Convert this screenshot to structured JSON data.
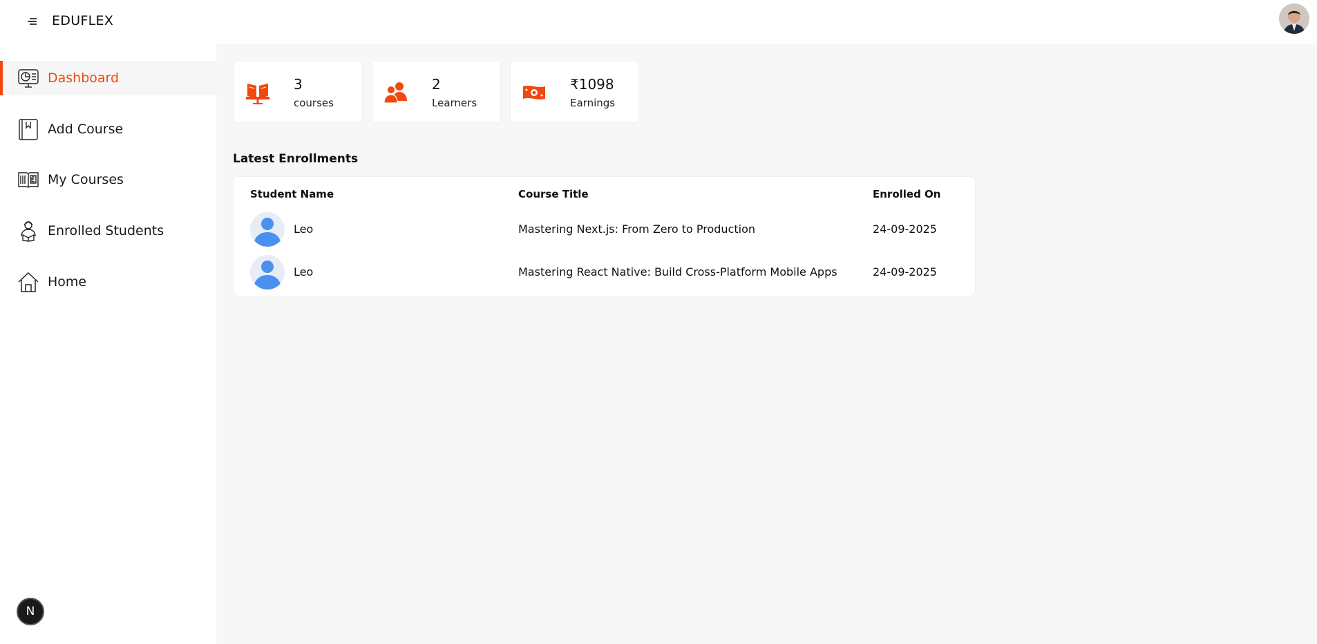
{
  "app": {
    "brand": "EDUFLEX"
  },
  "sidebar": {
    "items": [
      {
        "label": "Dashboard",
        "icon": "dashboard-icon",
        "active": true
      },
      {
        "label": "Add Course",
        "icon": "add-course-icon",
        "active": false
      },
      {
        "label": "My Courses",
        "icon": "my-courses-icon",
        "active": false
      },
      {
        "label": "Enrolled Students",
        "icon": "enrolled-students-icon",
        "active": false
      },
      {
        "label": "Home",
        "icon": "home-icon",
        "active": false
      }
    ],
    "badge": "N"
  },
  "stats": [
    {
      "value": "3",
      "label": "courses",
      "icon": "course-book-icon"
    },
    {
      "value": "2",
      "label": "Learners",
      "icon": "learners-icon"
    },
    {
      "value": "₹1098",
      "label": "Earnings",
      "icon": "money-icon"
    }
  ],
  "enrollments": {
    "title": "Latest Enrollments",
    "columns": [
      "Student Name",
      "Course Title",
      "Enrolled On"
    ],
    "rows": [
      {
        "student": "Leo",
        "course": "Mastering Next.js: From Zero to Production",
        "date": "24-09-2025"
      },
      {
        "student": "Leo",
        "course": "Mastering React Native: Build Cross-Platform Mobile Apps",
        "date": "24-09-2025"
      }
    ]
  },
  "colors": {
    "accent": "#f0490f",
    "avatar_blue": "#4a90f0",
    "background": "#f7f7f7"
  }
}
